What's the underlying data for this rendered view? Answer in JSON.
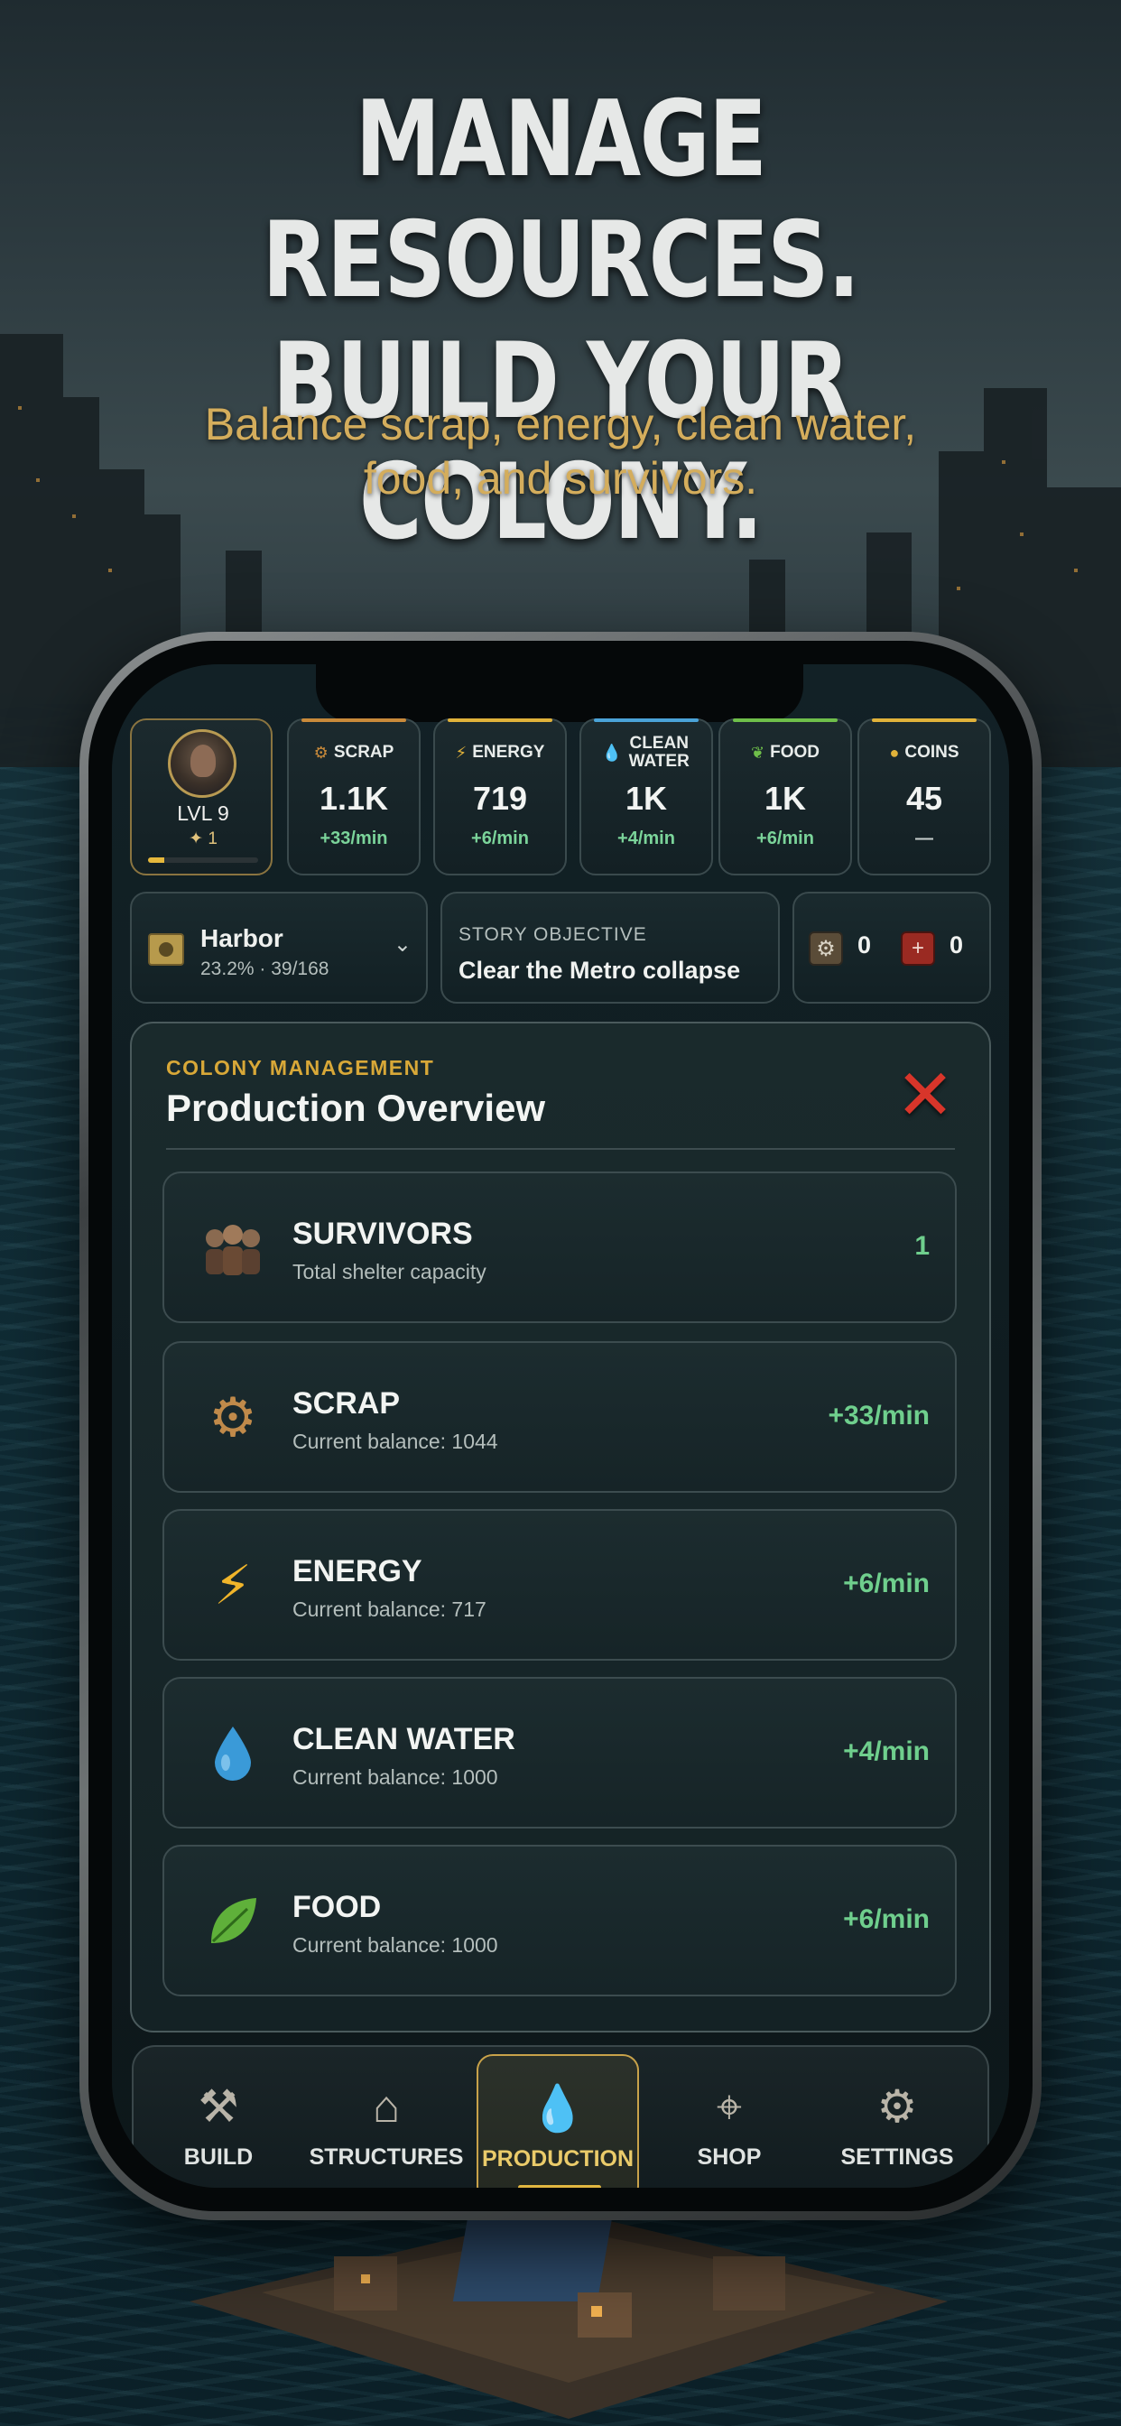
{
  "headline": {
    "line1": "MANAGE RESOURCES.",
    "line2": "BUILD YOUR COLONY.",
    "subline1": "Balance scrap, energy, clean water,",
    "subline2": "food, and survivors."
  },
  "player": {
    "level_label": "LVL 9",
    "sub_value": "1",
    "xp_progress": 0.15
  },
  "resources_bar": [
    {
      "label": "SCRAP",
      "value": "1.1K",
      "rate": "+33/min",
      "accent": "#c98a3a",
      "icon": "gear-icon"
    },
    {
      "label": "ENERGY",
      "value": "719",
      "rate": "+6/min",
      "accent": "#e0b23a",
      "icon": "lightning-icon"
    },
    {
      "label": "CLEAN WATER",
      "value": "1K",
      "rate": "+4/min",
      "accent": "#4aa3d8",
      "icon": "water-drop-icon"
    },
    {
      "label": "FOOD",
      "value": "1K",
      "rate": "+6/min",
      "accent": "#6fbf4a",
      "icon": "leaf-icon"
    },
    {
      "label": "COINS",
      "value": "45",
      "rate": "—",
      "accent": "#e0b23a",
      "icon": "coin-icon"
    }
  ],
  "zone": {
    "name": "Harbor",
    "meta": "23.2% · 39/168"
  },
  "objective": {
    "label": "STORY OBJECTIVE",
    "text": "Clear the Metro collapse"
  },
  "tokens": {
    "gear_count": "0",
    "box_count": "0"
  },
  "panel": {
    "kicker": "COLONY MANAGEMENT",
    "title": "Production Overview",
    "rows": [
      {
        "name": "SURVIVORS",
        "sub": "Total shelter capacity",
        "rate": "1",
        "icon": "survivors-icon"
      },
      {
        "name": "SCRAP",
        "sub": "Current balance: 1044",
        "rate": "+33/min",
        "icon": "gear-icon"
      },
      {
        "name": "ENERGY",
        "sub": "Current balance: 717",
        "rate": "+6/min",
        "icon": "lightning-icon"
      },
      {
        "name": "CLEAN WATER",
        "sub": "Current balance: 1000",
        "rate": "+4/min",
        "icon": "water-drop-icon"
      },
      {
        "name": "FOOD",
        "sub": "Current balance: 1000",
        "rate": "+6/min",
        "icon": "leaf-icon"
      }
    ]
  },
  "nav": {
    "items": [
      {
        "label": "BUILD",
        "icon": "hammer-icon"
      },
      {
        "label": "STRUCTURES",
        "icon": "structures-icon"
      },
      {
        "label": "PRODUCTION",
        "icon": "production-icon"
      },
      {
        "label": "SHOP",
        "icon": "compass-icon"
      },
      {
        "label": "SETTINGS",
        "icon": "gear-icon"
      }
    ],
    "active": "PRODUCTION"
  },
  "colors": {
    "accent_gold": "#d8a838",
    "positive_green": "#6fcf8d",
    "close_red": "#d8352a"
  }
}
